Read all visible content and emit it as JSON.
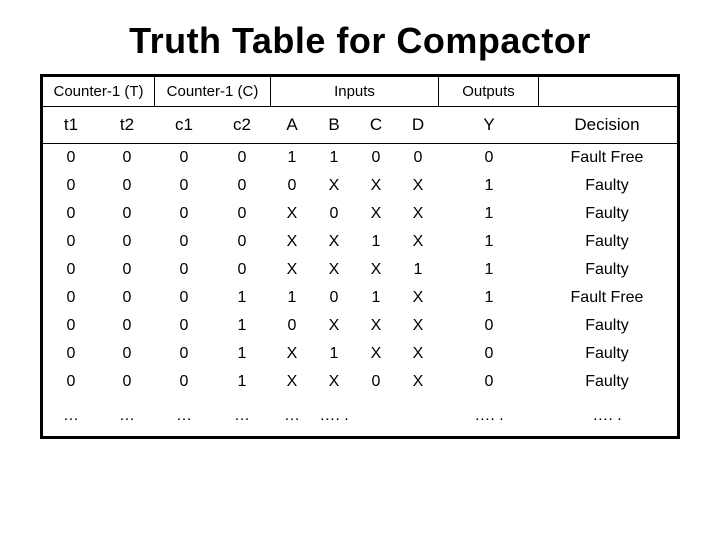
{
  "title": "Truth Table for Compactor",
  "group_headers": {
    "counter_t": "Counter-1 (T)",
    "counter_c": "Counter-1 (C)",
    "inputs": "Inputs",
    "outputs": "Outputs",
    "blank": ""
  },
  "sub_headers": {
    "t1": "t1",
    "t2": "t2",
    "c1": "c1",
    "c2": "c2",
    "A": "A",
    "B": "B",
    "C": "C",
    "D": "D",
    "Y": "Y",
    "Decision": "Decision"
  },
  "rows": [
    {
      "t1": "0",
      "t2": "0",
      "c1": "0",
      "c2": "0",
      "A": "1",
      "B": "1",
      "C": "0",
      "D": "0",
      "Y": "0",
      "Decision": "Fault Free"
    },
    {
      "t1": "0",
      "t2": "0",
      "c1": "0",
      "c2": "0",
      "A": "0",
      "B": "X",
      "C": "X",
      "D": "X",
      "Y": "1",
      "Decision": "Faulty"
    },
    {
      "t1": "0",
      "t2": "0",
      "c1": "0",
      "c2": "0",
      "A": "X",
      "B": "0",
      "C": "X",
      "D": "X",
      "Y": "1",
      "Decision": "Faulty"
    },
    {
      "t1": "0",
      "t2": "0",
      "c1": "0",
      "c2": "0",
      "A": "X",
      "B": "X",
      "C": "1",
      "D": "X",
      "Y": "1",
      "Decision": "Faulty"
    },
    {
      "t1": "0",
      "t2": "0",
      "c1": "0",
      "c2": "0",
      "A": "X",
      "B": "X",
      "C": "X",
      "D": "1",
      "Y": "1",
      "Decision": "Faulty"
    },
    {
      "t1": "0",
      "t2": "0",
      "c1": "0",
      "c2": "1",
      "A": "1",
      "B": "0",
      "C": "1",
      "D": "X",
      "Y": "1",
      "Decision": "Fault Free"
    },
    {
      "t1": "0",
      "t2": "0",
      "c1": "0",
      "c2": "1",
      "A": "0",
      "B": "X",
      "C": "X",
      "D": "X",
      "Y": "0",
      "Decision": "Faulty"
    },
    {
      "t1": "0",
      "t2": "0",
      "c1": "0",
      "c2": "1",
      "A": "X",
      "B": "1",
      "C": "X",
      "D": "X",
      "Y": "0",
      "Decision": "Faulty"
    },
    {
      "t1": "0",
      "t2": "0",
      "c1": "0",
      "c2": "1",
      "A": "X",
      "B": "X",
      "C": "0",
      "D": "X",
      "Y": "0",
      "Decision": "Faulty"
    }
  ],
  "ellipsis_row": {
    "t1": "…",
    "t2": "…",
    "c1": "…",
    "c2": "…",
    "A": "…",
    "B": "…. .",
    "C": "",
    "D": "",
    "Y": "…. .",
    "Decision": "…. ."
  },
  "chart_data": {
    "type": "table",
    "title": "Truth Table for Compactor",
    "columns": [
      "t1",
      "t2",
      "c1",
      "c2",
      "A",
      "B",
      "C",
      "D",
      "Y",
      "Decision"
    ],
    "column_groups": [
      {
        "label": "Counter-1 (T)",
        "span": [
          "t1",
          "t2"
        ]
      },
      {
        "label": "Counter-1 (C)",
        "span": [
          "c1",
          "c2"
        ]
      },
      {
        "label": "Inputs",
        "span": [
          "A",
          "B",
          "C",
          "D"
        ]
      },
      {
        "label": "Outputs",
        "span": [
          "Y"
        ]
      },
      {
        "label": "",
        "span": [
          "Decision"
        ]
      }
    ],
    "rows": [
      [
        "0",
        "0",
        "0",
        "0",
        "1",
        "1",
        "0",
        "0",
        "0",
        "Fault Free"
      ],
      [
        "0",
        "0",
        "0",
        "0",
        "0",
        "X",
        "X",
        "X",
        "1",
        "Faulty"
      ],
      [
        "0",
        "0",
        "0",
        "0",
        "X",
        "0",
        "X",
        "X",
        "1",
        "Faulty"
      ],
      [
        "0",
        "0",
        "0",
        "0",
        "X",
        "X",
        "1",
        "X",
        "1",
        "Faulty"
      ],
      [
        "0",
        "0",
        "0",
        "0",
        "X",
        "X",
        "X",
        "1",
        "1",
        "Faulty"
      ],
      [
        "0",
        "0",
        "0",
        "1",
        "1",
        "0",
        "1",
        "X",
        "1",
        "Fault Free"
      ],
      [
        "0",
        "0",
        "0",
        "1",
        "0",
        "X",
        "X",
        "X",
        "0",
        "Faulty"
      ],
      [
        "0",
        "0",
        "0",
        "1",
        "X",
        "1",
        "X",
        "X",
        "0",
        "Faulty"
      ],
      [
        "0",
        "0",
        "0",
        "1",
        "X",
        "X",
        "0",
        "X",
        "0",
        "Faulty"
      ],
      [
        "…",
        "…",
        "…",
        "…",
        "…",
        "…",
        "",
        "",
        "…",
        "…"
      ]
    ]
  }
}
